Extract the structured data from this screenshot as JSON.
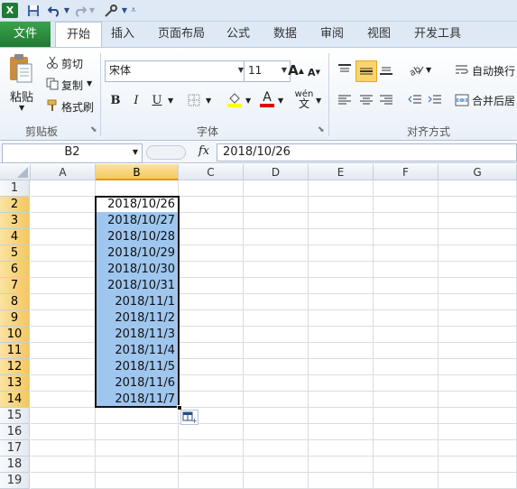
{
  "quick_access": {
    "undo_icon": "undo-icon",
    "redo_icon": "redo-icon"
  },
  "tabs": [
    {
      "label": "文件"
    },
    {
      "label": "开始"
    },
    {
      "label": "插入"
    },
    {
      "label": "页面布局"
    },
    {
      "label": "公式"
    },
    {
      "label": "数据"
    },
    {
      "label": "审阅"
    },
    {
      "label": "视图"
    },
    {
      "label": "开发工具"
    }
  ],
  "ribbon": {
    "clipboard": {
      "paste": "粘贴",
      "cut": "剪切",
      "copy": "复制",
      "format_painter": "格式刷",
      "group_label": "剪贴板"
    },
    "font": {
      "font_name": "宋体",
      "font_size": "11",
      "bold": "B",
      "italic": "I",
      "underline": "U",
      "phonetic": "wén",
      "group_label": "字体",
      "grow": "A",
      "shrink": "A",
      "font_color_letter": "A"
    },
    "alignment": {
      "wrap_text": "自动换行",
      "merge_center": "合并后居",
      "group_label": "对齐方式"
    }
  },
  "formula_bar": {
    "name_box": "B2",
    "fx": "fx",
    "formula": "2018/10/26"
  },
  "sheet": {
    "columns": [
      "A",
      "B",
      "C",
      "D",
      "E",
      "F",
      "G"
    ],
    "rows": [
      "1",
      "2",
      "3",
      "4",
      "5",
      "6",
      "7",
      "8",
      "9",
      "10",
      "11",
      "12",
      "13",
      "14",
      "15",
      "16",
      "17",
      "18",
      "19"
    ],
    "b_values": [
      "2018/10/26",
      "2018/10/27",
      "2018/10/28",
      "2018/10/29",
      "2018/10/30",
      "2018/10/31",
      "2018/11/1",
      "2018/11/2",
      "2018/11/3",
      "2018/11/4",
      "2018/11/5",
      "2018/11/6",
      "2018/11/7"
    ]
  },
  "colors": {
    "file_tab": "#2b8a3e",
    "selection": "#9fc6ee",
    "header_selected": "#f5c760"
  }
}
